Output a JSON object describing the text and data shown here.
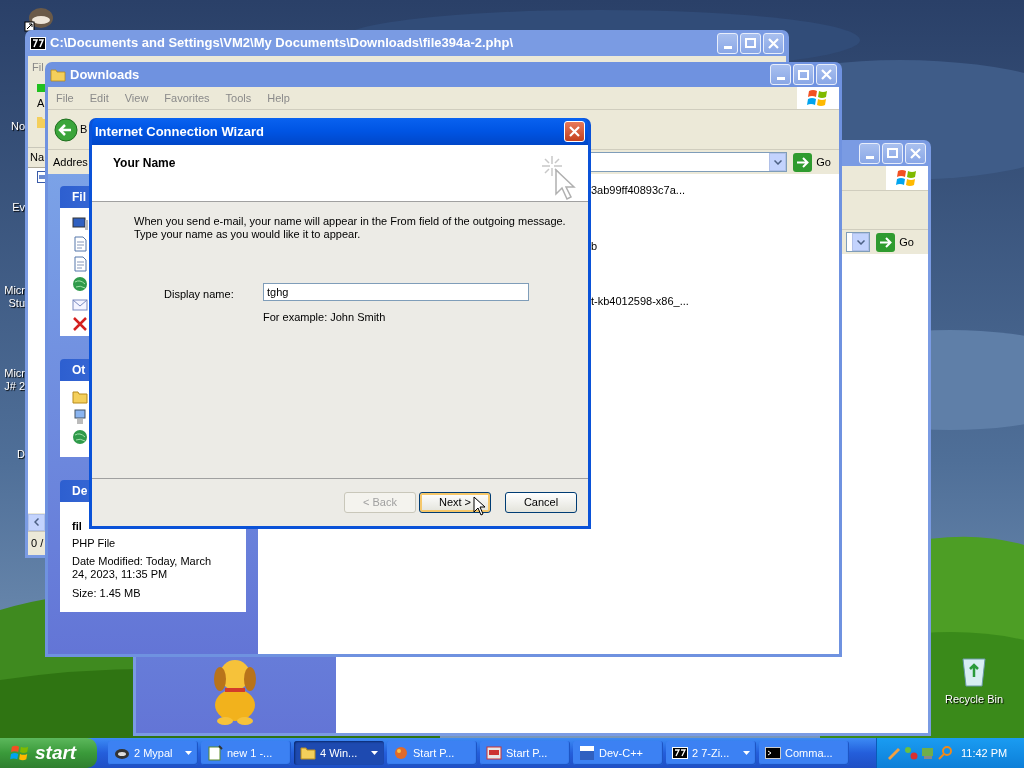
{
  "desktop": {
    "icon_labels": [
      {
        "lines": [
          "No"
        ]
      },
      {
        "lines": [
          "Ev"
        ]
      },
      {
        "lines": [
          "Micr",
          "Stu"
        ]
      },
      {
        "lines": [
          "Micr",
          "J# 2"
        ]
      },
      {
        "lines": [
          "D"
        ]
      }
    ],
    "recycle_bin": "Recycle Bin"
  },
  "archive_window": {
    "title": "C:\\Documents and Settings\\VM2\\My Documents\\Downloads\\file394a-2.php\\",
    "menu": "Fil",
    "toolbar_label": "A",
    "column_header": "Na",
    "status": "0 /"
  },
  "explorer_window": {
    "go": "Go"
  },
  "downloads_window": {
    "title": "Downloads",
    "menu": [
      "File",
      "Edit",
      "View",
      "Favorites",
      "Tools",
      "Help"
    ],
    "back_label": "B",
    "address_label": "Addres",
    "go": "Go",
    "task_panes": [
      {
        "title": "Fil"
      },
      {
        "title": "Ot"
      },
      {
        "title": "De"
      }
    ],
    "details": {
      "name": "fil",
      "type": "PHP File",
      "modified": "Date Modified: Today, March 24, 2023, 11:35 PM",
      "size": "Size: 1.45 MB"
    },
    "files": [
      "3ab99ff40893c7a...",
      "b",
      "t-kb4012598-x86_..."
    ]
  },
  "dialog": {
    "title": "Internet Connection Wizard",
    "heading": "Your Name",
    "description": [
      "When you send e-mail, your name will appear in the From field of the outgoing message.",
      "Type your name as you would like it to appear."
    ],
    "field": {
      "label": "Display name:",
      "value": "tghg",
      "example": "For example: John Smith"
    },
    "buttons": [
      {
        "label": "< Back",
        "disabled": true,
        "default": false
      },
      {
        "label": "Next >",
        "disabled": false,
        "default": true
      },
      {
        "label": "Cancel",
        "disabled": false,
        "default": false
      }
    ]
  },
  "taskbar": {
    "start": "start",
    "tasks": [
      {
        "label": "2 Mypal",
        "grouped": true,
        "selected": false
      },
      {
        "label": "new 1 -...",
        "grouped": false,
        "selected": false
      },
      {
        "label": "4 Win...",
        "grouped": true,
        "selected": true
      },
      {
        "label": "Start P...",
        "grouped": false,
        "selected": false
      },
      {
        "label": "Start P...",
        "grouped": false,
        "selected": false
      },
      {
        "label": "Dev-C++",
        "grouped": false,
        "selected": false
      },
      {
        "label": "2 7-Zi...",
        "grouped": true,
        "selected": false
      },
      {
        "label": "Comma...",
        "grouped": false,
        "selected": false
      }
    ],
    "clock": "11:42 PM"
  }
}
